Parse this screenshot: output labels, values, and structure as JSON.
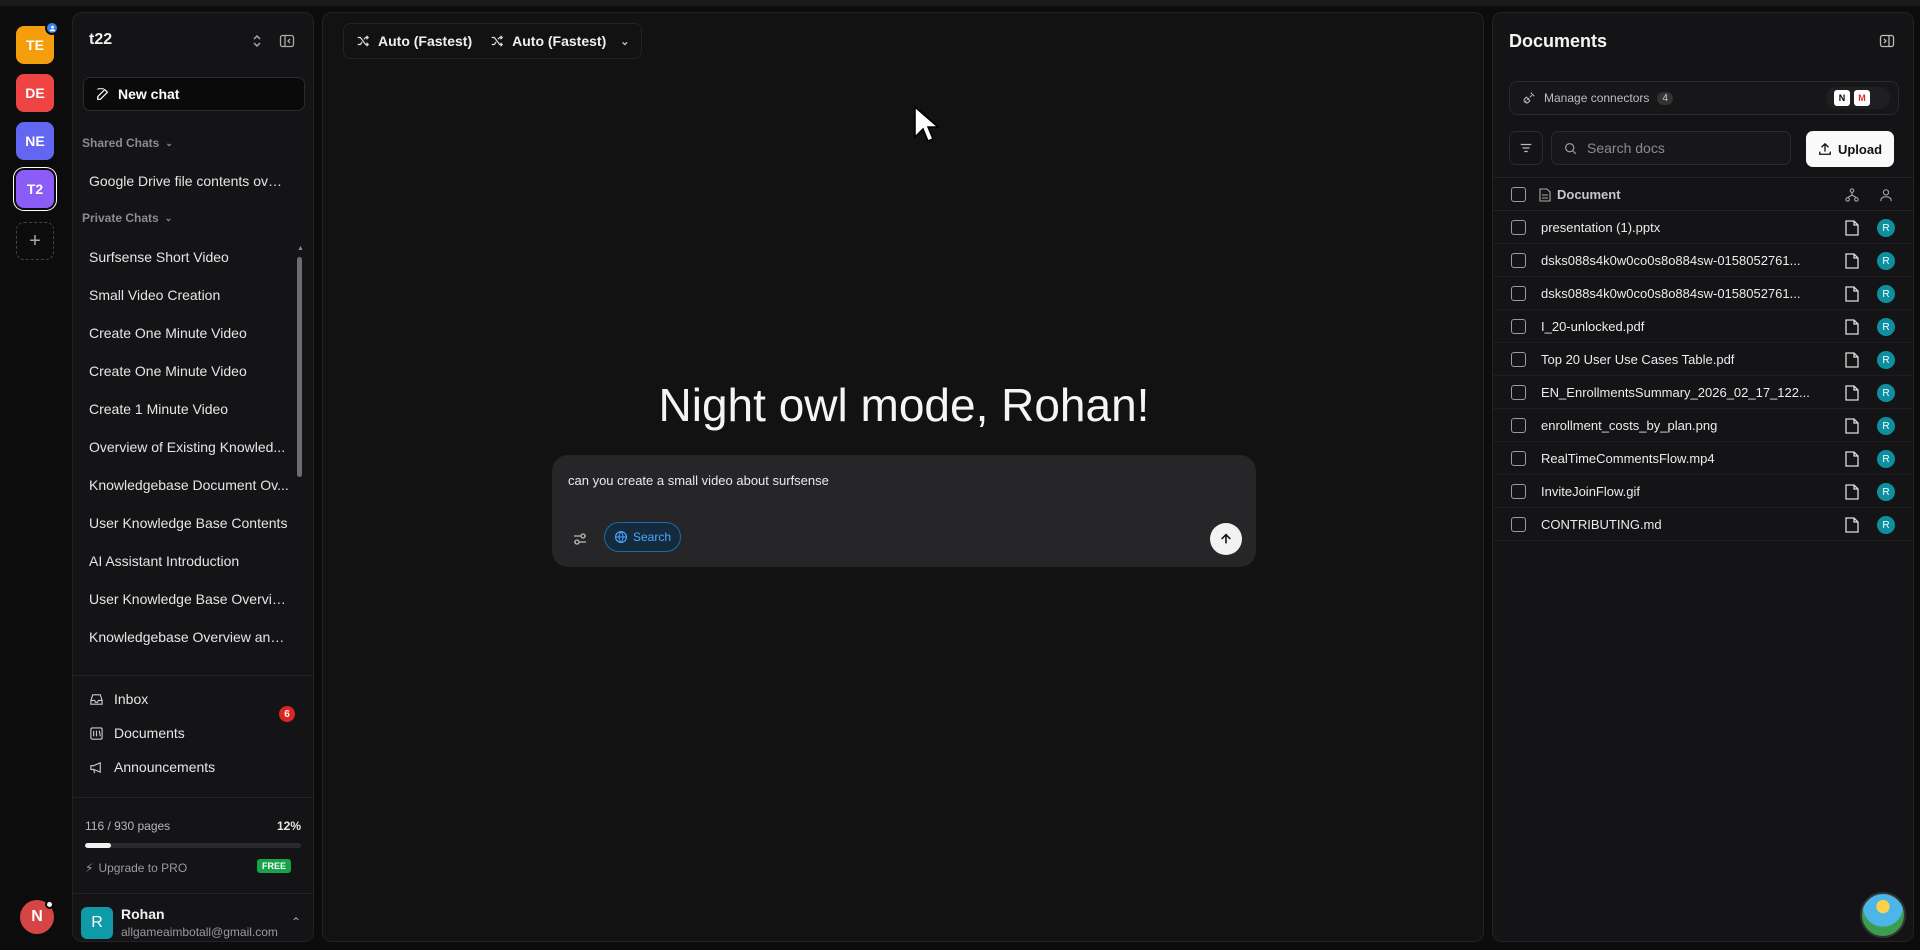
{
  "workspaces": [
    {
      "label": "TE",
      "color": "#f59e0b"
    },
    {
      "label": "DE",
      "color": "#ef4444"
    },
    {
      "label": "NE",
      "color": "#6366f1"
    },
    {
      "label": "T2",
      "color": "#8b5cf6"
    }
  ],
  "rail_avatar": "N",
  "sidebar": {
    "title": "t22",
    "new_chat": "New chat",
    "shared_label": "Shared Chats",
    "shared_chats": [
      "Google Drive file contents overv..."
    ],
    "private_label": "Private Chats",
    "private_chats": [
      "Surfsense Short Video",
      "Small Video Creation",
      "Create One Minute Video",
      "Create One Minute Video",
      "Create 1 Minute Video",
      "Overview of Existing Knowled...",
      "Knowledgebase Document Ov...",
      "User Knowledge Base Contents",
      "AI Assistant Introduction",
      "User Knowledge Base Overview",
      "Knowledgebase Overview and..."
    ],
    "nav": {
      "inbox": "Inbox",
      "inbox_count": "6",
      "documents": "Documents",
      "announcements": "Announcements"
    },
    "usage": {
      "text": "116 / 930 pages",
      "percent": "12%",
      "fraction": 0.12
    },
    "upgrade": "Upgrade to PRO",
    "free_badge": "FREE",
    "user": {
      "initial": "R",
      "name": "Rohan",
      "email": "allgameaimbotall@gmail.com"
    }
  },
  "main": {
    "model_1": "Auto (Fastest)",
    "model_2": "Auto (Fastest)",
    "greeting": "Night owl mode, Rohan!",
    "composer_text": "can you create a small video about surfsense",
    "search_label": "Search"
  },
  "docs": {
    "title": "Documents",
    "connectors_label": "Manage connectors",
    "connectors_count": "4",
    "search_placeholder": "Search docs",
    "upload_label": "Upload",
    "column_document": "Document",
    "rows": [
      "presentation (1).pptx",
      "dsks088s4k0w0co0s8o884sw-0158052761...",
      "dsks088s4k0w0co0s8o884sw-0158052761...",
      "I_20-unlocked.pdf",
      "Top 20 User Use Cases Table.pdf",
      "EN_EnrollmentsSummary_2026_02_17_122...",
      "enrollment_costs_by_plan.png",
      "RealTimeCommentsFlow.mp4",
      "InviteJoinFlow.gif",
      "CONTRIBUTING.md"
    ],
    "row_owner": "R"
  }
}
